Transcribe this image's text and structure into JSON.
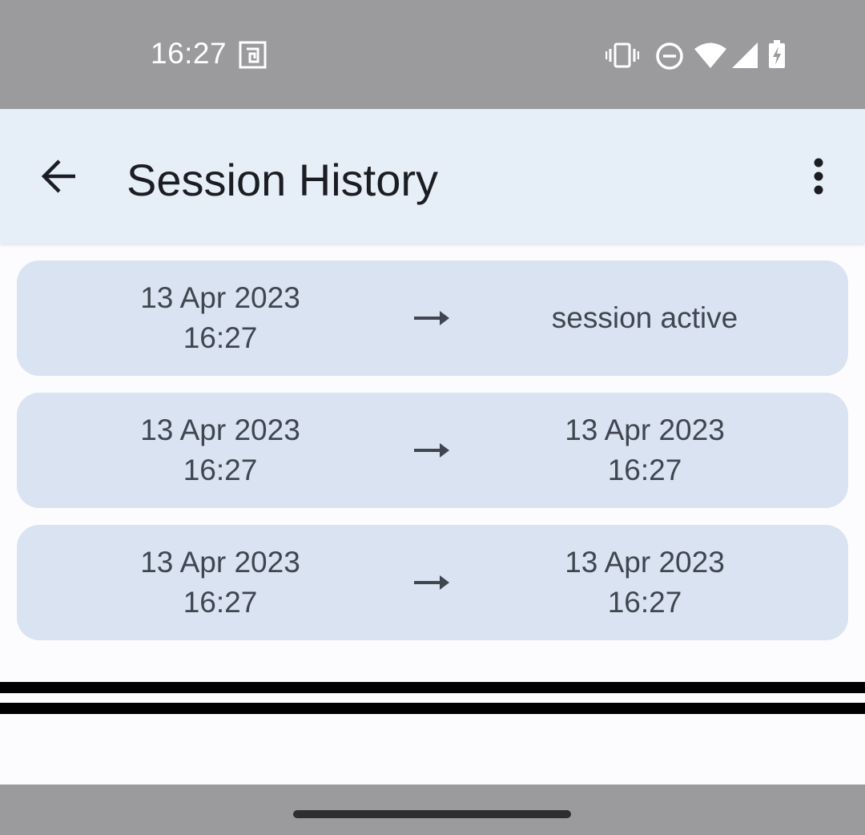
{
  "status_bar": {
    "time": "16:27",
    "icons": [
      "nfc-icon",
      "vibrate-icon",
      "do-not-disturb-icon",
      "wifi-icon",
      "cell-signal-icon",
      "battery-charging-icon"
    ]
  },
  "app_bar": {
    "title": "Session History",
    "back_icon": "arrow-back-icon",
    "menu_icon": "more-vert-icon"
  },
  "sessions": [
    {
      "start_date": "13 Apr 2023",
      "start_time": "16:27",
      "end_status": "session active"
    },
    {
      "start_date": "13 Apr 2023",
      "start_time": "16:27",
      "end_date": "13 Apr 2023",
      "end_time": "16:27"
    },
    {
      "start_date": "13 Apr 2023",
      "start_time": "16:27",
      "end_date": "13 Apr 2023",
      "end_time": "16:27"
    }
  ],
  "colors": {
    "status_bar": "#9b9b9d",
    "app_bar": "#e6eef8",
    "card": "#d9e3f1",
    "card_text": "#3f4650",
    "background": "#fcfcff"
  }
}
